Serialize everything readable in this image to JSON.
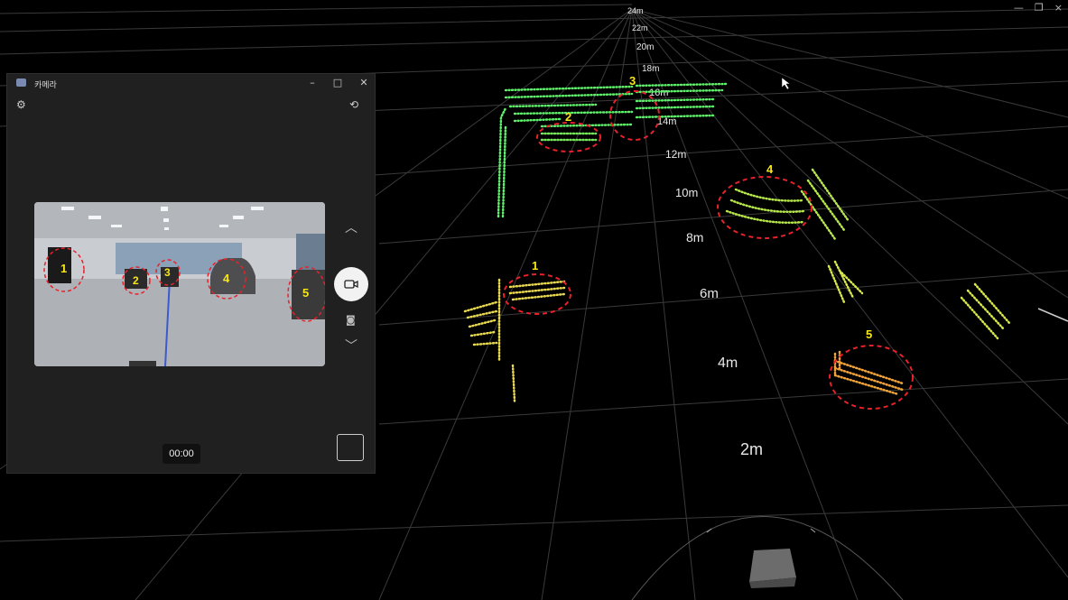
{
  "window_controls": {
    "minimize": "—",
    "restore": "❐",
    "close": "×"
  },
  "camera_app": {
    "title": "카메라",
    "controls": {
      "minimize": "–",
      "maximize": "□",
      "close": "✕"
    },
    "icons": {
      "settings": "gear-icon",
      "switch_camera": "camera-switch-icon",
      "video": "video-icon",
      "photo": "camera-icon"
    },
    "timer": "00:00",
    "preview_markers": [
      "1",
      "2",
      "3",
      "4",
      "5"
    ]
  },
  "lidar": {
    "distance_labels": [
      "24m",
      "22m",
      "20m",
      "18m",
      "16m",
      "14m",
      "12m",
      "10m",
      "8m",
      "6m",
      "4m",
      "2m"
    ],
    "object_markers": [
      "1",
      "2",
      "3",
      "4",
      "5"
    ],
    "colors": {
      "near": "#e8d850",
      "far": "#5ef06a",
      "orange": "#f2a33a",
      "marker_ring": "#e8212a",
      "marker_text": "#f7e61c"
    }
  }
}
